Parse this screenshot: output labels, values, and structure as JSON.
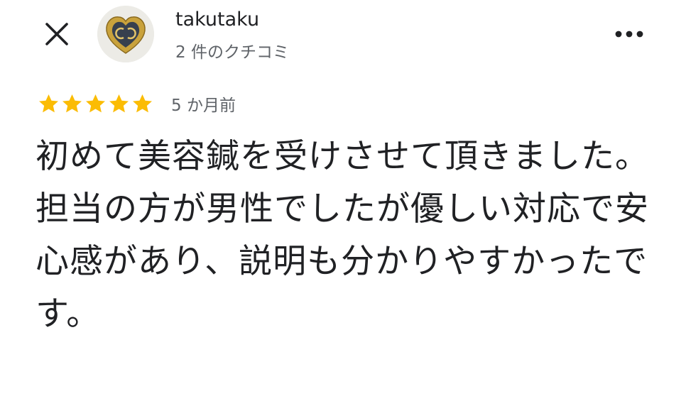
{
  "header": {
    "username": "takutaku",
    "review_count": "2 件のクチコミ"
  },
  "review": {
    "rating": 5,
    "max_rating": 5,
    "time_ago": "5 か月前",
    "text": "初めて美容鍼を受けさせて頂きました。\n担当の方が男性でしたが優しい対応で安心感があり、説明も分かりやすかったです。"
  },
  "colors": {
    "star": "#FBBC04",
    "text_primary": "#202124",
    "text_secondary": "#5f6368"
  },
  "icons": {
    "close": "close-icon",
    "more": "more-vert-icon",
    "star": "star-icon"
  }
}
